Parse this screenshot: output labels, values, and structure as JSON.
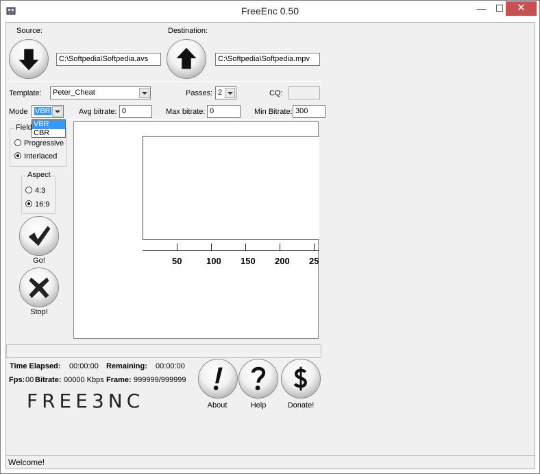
{
  "window": {
    "title": "FreeEnc 0.50",
    "minimize": "—",
    "maximize": "☐",
    "close": "✕"
  },
  "source": {
    "label": "Source:",
    "path": "C:\\Softpedia\\Softpedia.avs"
  },
  "destination": {
    "label": "Destination:",
    "path": "C:\\Softpedia\\Softpedia.mpv"
  },
  "settings": {
    "template_label": "Template:",
    "template_value": "Peter_Cheat",
    "passes_label": "Passes:",
    "passes_value": "2",
    "cq_label": "CQ:",
    "cq_value": "",
    "mode_label": "Mode",
    "mode_value": "VBR",
    "mode_options": [
      "VBR",
      "CBR"
    ],
    "avg_bitrate_label": "Avg bitrate:",
    "avg_bitrate_value": "0",
    "max_bitrate_label": "Max bitrate:",
    "max_bitrate_value": "0",
    "min_bitrate_label": "Min Bitrate:",
    "min_bitrate_value": "300"
  },
  "field": {
    "title": "Field",
    "progressive": "Progressive",
    "interlaced": "Interlaced",
    "selected": "Interlaced"
  },
  "aspect": {
    "title": "Aspect",
    "ratio_4_3": "4:3",
    "ratio_16_9": "16:9",
    "selected": "16:9"
  },
  "actions": {
    "go": "Go!",
    "stop": "Stop!",
    "about": "About",
    "help": "Help",
    "donate": "Donate!"
  },
  "graph": {
    "x_ticks": [
      "50",
      "100",
      "150",
      "200",
      "25"
    ]
  },
  "stats": {
    "time_elapsed_label": "Time Elapsed:",
    "time_elapsed_value": "00:00:00",
    "remaining_label": "Remaining:",
    "remaining_value": "00:00:00",
    "fps_label": "Fps:",
    "fps_value": "00",
    "bitrate_label": "Bitrate:",
    "bitrate_value": "00000 Kbps",
    "frame_label": "Frame:",
    "frame_value": "999999/999999"
  },
  "logo": {
    "text": "FREE3NC"
  },
  "status": {
    "text": "Welcome!"
  },
  "colors": {
    "title_bg": "#ffffff",
    "close_bg": "#c75050",
    "client_bg": "#f0f0f0",
    "selection": "#3399ff"
  }
}
